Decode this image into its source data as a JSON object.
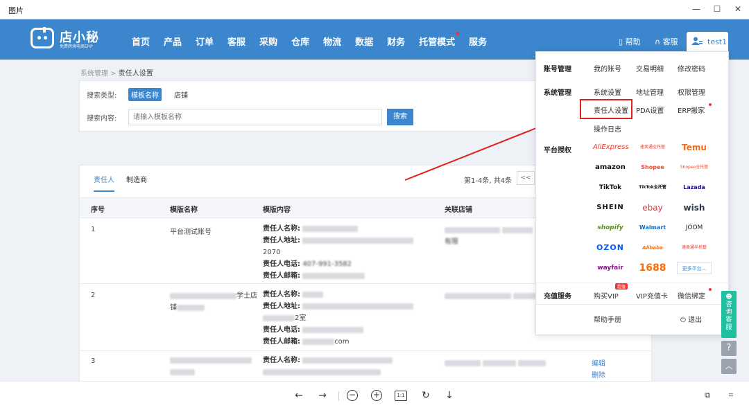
{
  "window": {
    "title": "图片",
    "min": "—",
    "max": "☐",
    "close": "✕"
  },
  "app": {
    "logo_name": "店小秘",
    "logo_sub": "免费跨境电商ERP",
    "nav": [
      "首页",
      "产品",
      "订单",
      "客服",
      "采购",
      "仓库",
      "物流",
      "数据",
      "财务",
      "托管模式",
      "服务"
    ],
    "help": "帮助",
    "service": "客服",
    "username": "test1"
  },
  "breadcrumb": {
    "parent": "系统管理",
    "sep": ">",
    "current": "责任人设置"
  },
  "search": {
    "type_label": "搜索类型:",
    "type_options": [
      "模板名称",
      "店铺"
    ],
    "content_label": "搜索内容:",
    "placeholder": "请输入模板名称",
    "button": "搜索"
  },
  "table": {
    "tabs": [
      "责任人",
      "制造商"
    ],
    "pager_text": "第1-4条, 共4条",
    "pager_prev": "<<",
    "columns": [
      "序号",
      "模版名称",
      "模版内容",
      "关联店铺"
    ],
    "field_labels": [
      "责任人名称:",
      "责任人地址:",
      "责任人电话:",
      "责任人邮箱:"
    ],
    "rows": [
      {
        "index": "1",
        "name": "平台测试账号",
        "addr_tail": "2070",
        "phone_text": "407-991-3582",
        "shop_tail": "有限"
      },
      {
        "index": "2",
        "name_tail": "学士店",
        "name_line2": "铺",
        "addr_tail": "2室",
        "email_tail": "com"
      },
      {
        "index": "3",
        "edit": "编辑",
        "delete": "删除"
      }
    ]
  },
  "dropdown": {
    "account_mgmt": "账号管理",
    "account_links": [
      "我的账号",
      "交易明细",
      "修改密码"
    ],
    "system_mgmt": "系统管理",
    "system_links": [
      "系统设置",
      "地址管理",
      "权限管理",
      "责任人设置",
      "PDA设置",
      "ERP搬家",
      "操作日志"
    ],
    "platform_auth": "平台授权",
    "platforms": [
      "AliExpress",
      "速卖通全托管",
      "Temu",
      "amazon",
      "Shopee",
      "Shopee全托管",
      "TikTok",
      "TikTok全托管",
      "Lazada",
      "SHEIN",
      "ebay",
      "wish",
      "shopify",
      "Walmart",
      "JOOM",
      "OZON",
      "Alibaba",
      "速卖通半托管",
      "wayfair",
      "1688",
      "更多平台..."
    ],
    "recharge": "充值服务",
    "recharge_links": [
      "购买VIP",
      "VIP充值卡",
      "微信绑定"
    ],
    "vip_badge": "超值",
    "help_manual": "帮助手册",
    "logout": "退出"
  },
  "side": {
    "consult": "咨询客服",
    "help": "?",
    "top": "︿"
  },
  "viewer": {
    "prev": "←",
    "next": "→",
    "zoom_out": "−",
    "zoom_in": "+",
    "ratio": "1:1",
    "rotate": "↻",
    "download": "↓"
  },
  "colors": {
    "brand": "#3b86cc",
    "highlight": "#e02020",
    "consult": "#1fbfa0"
  }
}
